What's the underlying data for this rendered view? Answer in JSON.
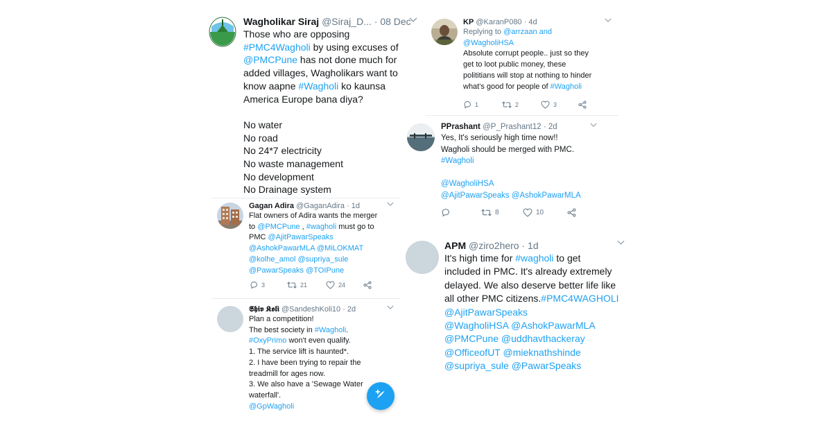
{
  "tweets": [
    {
      "name": "Wagholikar Siraj",
      "handle": "@Siraj_D...",
      "time": "· 08 Dec",
      "body": [
        {
          "t": "Those who are opposing\n"
        },
        {
          "t": "#PMC4Wagholi",
          "hl": true
        },
        {
          "t": " by using excuses of\n"
        },
        {
          "t": "@PMCPune",
          "hl": true
        },
        {
          "t": " has not done much for\nadded villages, Wagholikars want to\nknow aapne "
        },
        {
          "t": "#Wagholi",
          "hl": true
        },
        {
          "t": " ko kaunsa\nAmerica Europe bana diya?\n\nNo water\nNo road\nNo 24*7 electricity\nNo waste management\nNo development\nNo Drainage system"
        }
      ]
    },
    {
      "name": "Gagan Adira",
      "handle": "@GaganAdira",
      "time": "· 1d",
      "body": [
        {
          "t": "Flat owners of Adira wants the merger\nto "
        },
        {
          "t": "@PMCPune",
          "hl": true
        },
        {
          "t": " , "
        },
        {
          "t": "#wagholi",
          "hl": true
        },
        {
          "t": " must go to\nPMC "
        },
        {
          "t": "@AjitPawarSpeaks\n@AshokPawarMLA @MiLOKMAT\n@kolhe_amol @supriya_sule\n@PawarSpeaks @TOIPune",
          "hl": true
        }
      ],
      "replies": "3",
      "retweets": "21",
      "likes": "24"
    },
    {
      "name": "𝕾𝖍𝖎𝖛 𝕶𝖔𝖑𝖎",
      "handle": "@SandeshKoli10",
      "time": "· 2d",
      "body": [
        {
          "t": "Plan a competition!\nThe best society in "
        },
        {
          "t": "#Wagholi",
          "hl": true
        },
        {
          "t": ".\n"
        },
        {
          "t": "#OxyPrimo",
          "hl": true
        },
        {
          "t": " won't even qualify.\n1. The service lift is haunted*.\n2. I have been trying to repair the\ntreadmill for ages now.\n3. We also have a 'Sewage Water\nwaterfall'.\n"
        },
        {
          "t": "@GpWagholi",
          "hl": true
        }
      ]
    },
    {
      "name": "KP",
      "handle": "@KaranP080",
      "time": "· 4d",
      "replying_prefix": "Replying to ",
      "replying_to": "@arrzaan and\n@WagholiHSA",
      "body": [
        {
          "t": "Absolute corrupt people.. just so they\nget to loot public money, these\npolititians will stop at nothing to hinder\nwhat's good for people of "
        },
        {
          "t": "#Wagholi",
          "hl": true
        }
      ],
      "replies": "1",
      "retweets": "2",
      "likes": "3"
    },
    {
      "name": "PPrashant",
      "handle": "@P_Prashant12",
      "time": "· 2d",
      "body": [
        {
          "t": "Yes, It's seriously high time now!!\nWagholi should be merged with PMC.\n"
        },
        {
          "t": "#Wagholi",
          "hl": true
        },
        {
          "t": "\n\n"
        },
        {
          "t": "@WagholiHSA\n@AjitPawarSpeaks @AshokPawarMLA",
          "hl": true
        }
      ],
      "replies": "",
      "retweets": "8",
      "likes": "10"
    },
    {
      "name": "APM",
      "handle": "@ziro2hero",
      "time": "· 1d",
      "body": [
        {
          "t": "It's high time for "
        },
        {
          "t": "#wagholi",
          "hl": true
        },
        {
          "t": " to get\nincluded in PMC. It's already extremely\ndelayed. We also deserve better life like\nall other PMC citizens."
        },
        {
          "t": "#PMC4WAGHOLI\n@AjitPawarSpeaks\n@WagholiHSA @AshokPawarMLA\n@PMCPune @uddhavthackeray\n@OfficeofUT @mieknathshinde\n@supriya_sule @PawarSpeaks",
          "hl": true
        }
      ]
    }
  ],
  "colors": {
    "accent": "#1da1f2",
    "text": "#14171a",
    "muted": "#657786",
    "divider": "#e6ecf0"
  },
  "icons": [
    "reply-icon",
    "retweet-icon",
    "like-icon",
    "share-icon",
    "compose-tweet-icon",
    "caret-down-icon"
  ]
}
